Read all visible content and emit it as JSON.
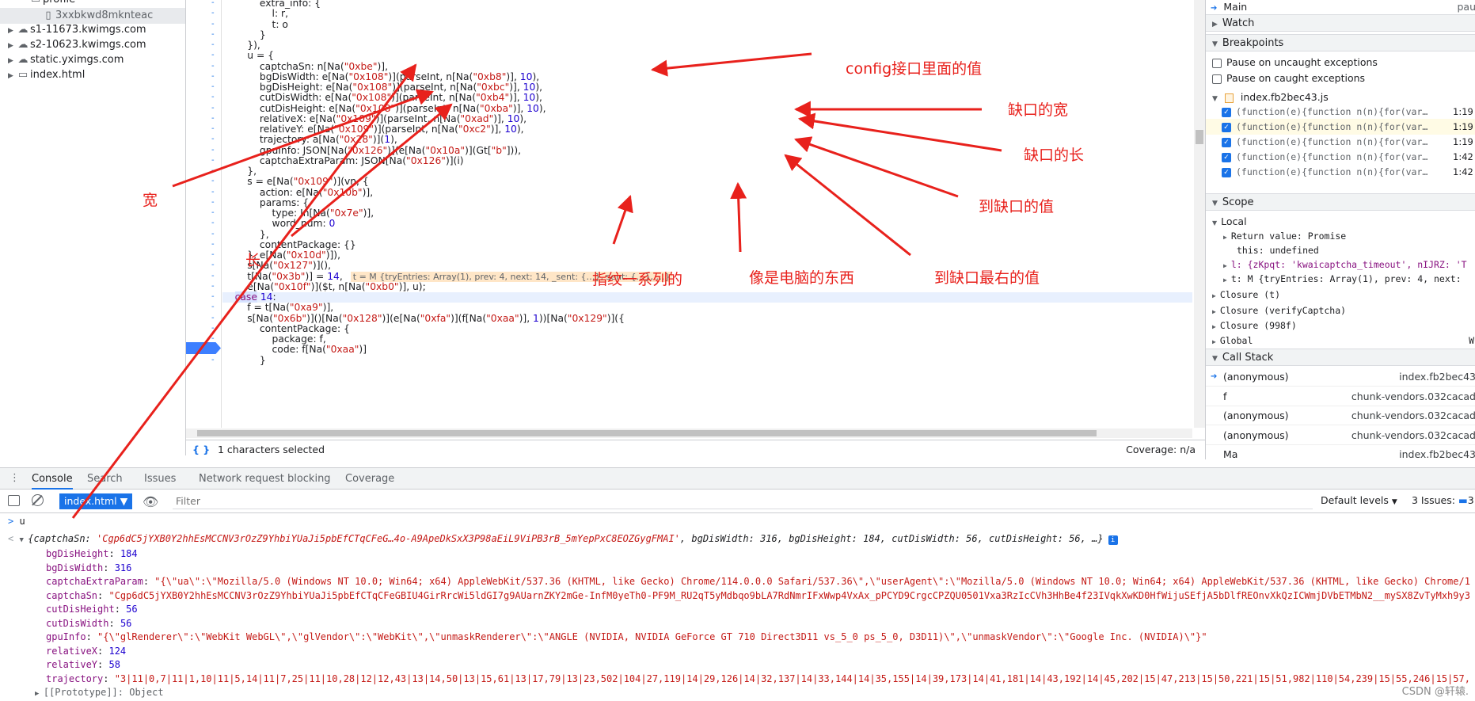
{
  "file_tree": {
    "items": [
      {
        "label": "profile",
        "icon": "folder-icon",
        "indent": 2
      },
      {
        "label": "3xxbkwd8mknteac",
        "icon": "file-icon",
        "indent": 3,
        "selected": true
      },
      {
        "label": "s1-11673.kwimgs.com",
        "icon": "cloud-icon",
        "indent": 1
      },
      {
        "label": "s2-10623.kwimgs.com",
        "icon": "cloud-icon",
        "indent": 1
      },
      {
        "label": "static.yximgs.com",
        "icon": "cloud-icon",
        "indent": 1
      },
      {
        "label": "index.html",
        "icon": "frame-icon",
        "indent": 1
      }
    ]
  },
  "editor": {
    "lines": [
      "            extra_info: {",
      "                l: r,",
      "                t: o",
      "            }",
      "        }),",
      "        u = {",
      "            captchaSn: n[Na(\"0xbe\")],",
      "            bgDisWidth: e[Na(\"0x108\")](parseInt, n[Na(\"0xb8\")], 10),",
      "            bgDisHeight: e[Na(\"0x108\")](parseInt, n[Na(\"0xbc\")], 10),",
      "            cutDisWidth: e[Na(\"0x108\")](parseInt, n[Na(\"0xb4\")], 10),",
      "            cutDisHeight: e[Na(\"0x108\")](parseInt, n[Na(\"0xba\")], 10),",
      "            relativeX: e[Na(\"0x109\")](parseInt, n[Na(\"0xad\")], 10),",
      "            relativeY: e[Na(\"0x109\")](parseInt, n[Na(\"0xc2\")], 10),",
      "            trajectory: a[Na(\"0x28\")](1),",
      "            gpuInfo: JSON[Na(\"0x126\")](e[Na(\"0x10a\")](Gt[\"b\"])),",
      "            captchaExtraParam: JSON[Na(\"0x126\")](i)",
      "        },",
      "        s = e[Na(\"0x109\")](vn, {",
      "            action: e[Na(\"0x10b\")],",
      "            params: {",
      "                type: In[Na(\"0x7e\")],",
      "                word_num: 0",
      "            },",
      "            contentPackage: {}",
      "        }, e[Na(\"0x10d\")]),",
      "        s[Na(\"0x127\")](),",
      "        t[Na(\"0x3b\")] = 14,",
      "        e[Na(\"0x10f\")]($t, n[Na(\"0xb0\")], u);",
      "    case 14:",
      "        f = t[Na(\"0xa9\")],",
      "        s[Na(\"0x6b\")]()[Na(\"0x128\")](e[Na(\"0xfa\")](f[Na(\"0xaa\")], 1))[Na(\"0x129\")]({",
      "            contentPackage: {",
      "                package: f,",
      "                code: f[Na(\"0xaa\")]",
      "            }"
    ],
    "inline_value": "t = M {tryEntries: Array(1), prev: 4, next: 14, _sent: {…}, sent: {…}, …}",
    "paused_line_index": 28
  },
  "status_bar": {
    "selection": "1 characters selected",
    "coverage": "Coverage: n/a",
    "braces": "{ }"
  },
  "right_panel": {
    "main_label": "Main",
    "main_status": "pau",
    "watch": "Watch",
    "breakpoints": "Breakpoints",
    "pause_uncaught": "Pause on uncaught exceptions",
    "pause_caught": "Pause on caught exceptions",
    "bp_file": "index.fb2bec43.js",
    "bp_items": [
      {
        "code": "(function(e){function n(n){for(var…",
        "line": "1:19"
      },
      {
        "code": "(function(e){function n(n){for(var…",
        "line": "1:19"
      },
      {
        "code": "(function(e){function n(n){for(var…",
        "line": "1:19"
      },
      {
        "code": "(function(e){function n(n){for(var…",
        "line": "1:42"
      },
      {
        "code": "(function(e){function n(n){for(var…",
        "line": "1:42"
      }
    ],
    "scope": "Scope",
    "local": "Local",
    "return_value": "Return value: Promise",
    "this_value": "this: undefined",
    "scope_l": "l: {zKpqt: 'kwaicaptcha_timeout', nIJRZ: 'T",
    "scope_t": "t: M {tryEntries: Array(1), prev: 4, next:",
    "closures": [
      "Closure (t)",
      "Closure (verifyCaptcha)",
      "Closure (998f)",
      "Global"
    ],
    "global_suffix": "W",
    "call_stack": "Call Stack",
    "frames": [
      {
        "fn": "(anonymous)",
        "loc": "index.fb2bec43",
        "current": true
      },
      {
        "fn": "f",
        "loc": "chunk-vendors.032cacad"
      },
      {
        "fn": "(anonymous)",
        "loc": "chunk-vendors.032cacad"
      },
      {
        "fn": "(anonymous)",
        "loc": "chunk-vendors.032cacad"
      },
      {
        "fn": "Ma",
        "loc": "index.fb2bec43"
      }
    ]
  },
  "drawer": {
    "tabs": [
      "Console",
      "Search",
      "Issues",
      "Network request blocking",
      "Coverage"
    ],
    "active_tab": "Console",
    "context": "index.html",
    "filter_placeholder": "Filter",
    "default_levels": "Default levels",
    "issues": "3 Issues:",
    "issues_count": "3"
  },
  "console": {
    "input": "u",
    "summary_pre": "{captchaSn: ",
    "summary_sn": "'Cgp6dC5jYXB0Y2hhEsMCCNV3rOzZ9YhbiYUaJi5pbEfCTqCFeG…4o-A9ApeDkSxX3P98aEiL9ViPB3rB_5mYepPxC8EOZGygFMAI'",
    "summary_rest": ", bgDisWidth: 316, bgDisHeight: 184, cutDisWidth: 56, cutDisHeight: 56, …}",
    "props": [
      {
        "k": "bgDisHeight",
        "v": "184",
        "t": "num"
      },
      {
        "k": "bgDisWidth",
        "v": "316",
        "t": "num"
      },
      {
        "k": "captchaExtraParam",
        "v": "\"{\\\"ua\\\":\\\"Mozilla/5.0 (Windows NT 10.0; Win64; x64) AppleWebKit/537.36 (KHTML, like Gecko) Chrome/114.0.0.0 Safari/537.36\\\",\\\"userAgent\\\":\\\"Mozilla/5.0 (Windows NT 10.0; Win64; x64) AppleWebKit/537.36 (KHTML, like Gecko) Chrome/1",
        "t": "str"
      },
      {
        "k": "captchaSn",
        "v": "\"Cgp6dC5jYXB0Y2hhEsMCCNV3rOzZ9YhbiYUaJi5pbEfCTqCFeGBIU4GirRrcWi5ldGI7g9AUarnZKY2mGe-InfM0yeTh0-PF9M_RU2qT5yMdbqo9bLA7RdNmrIFxWwp4VxAx_pPCYD9CrgcCPZQU0501Vxa3RzIcCVh3HhBe4f23IVqkXwKD0HfWijuSEfjA5bDlfREOnvXkQzICWmjDVbETMbN2__mySX8ZvTyMxh9y3",
        "t": "str"
      },
      {
        "k": "cutDisHeight",
        "v": "56",
        "t": "num"
      },
      {
        "k": "cutDisWidth",
        "v": "56",
        "t": "num"
      },
      {
        "k": "gpuInfo",
        "v": "\"{\\\"glRenderer\\\":\\\"WebKit WebGL\\\",\\\"glVendor\\\":\\\"WebKit\\\",\\\"unmaskRenderer\\\":\\\"ANGLE (NVIDIA, NVIDIA GeForce GT 710 Direct3D11 vs_5_0 ps_5_0, D3D11)\\\",\\\"unmaskVendor\\\":\\\"Google Inc. (NVIDIA)\\\"}\"",
        "t": "str"
      },
      {
        "k": "relativeX",
        "v": "124",
        "t": "num"
      },
      {
        "k": "relativeY",
        "v": "58",
        "t": "num"
      },
      {
        "k": "trajectory",
        "v": "\"3|11|0,7|11|1,10|11|5,14|11|7,25|11|10,28|12|12,43|13|14,50|13|15,61|13|17,79|13|23,502|104|27,119|14|29,126|14|32,137|14|33,144|14|35,155|14|39,173|14|41,181|14|43,192|14|45,202|15|47,213|15|50,221|15|51,982|110|54,239|15|55,246|15|57,",
        "t": "str"
      }
    ],
    "prototype": "[[Prototype]]: Object"
  },
  "annotations": {
    "config": "config接口里面的值",
    "gap_width": "缺口的宽",
    "gap_length": "缺口的长",
    "to_gap": "到缺口的值",
    "to_gap_right": "到缺口最右的值",
    "fingerprint": "指纹一系列的",
    "computer": "像是电脑的东西",
    "width": "宽",
    "length": "长"
  },
  "watermark": "CSDN @轩辕.",
  "colors": {
    "annotation": "#e8211c",
    "accent": "#1a73e8",
    "paused_line": "#e8f0fe"
  }
}
